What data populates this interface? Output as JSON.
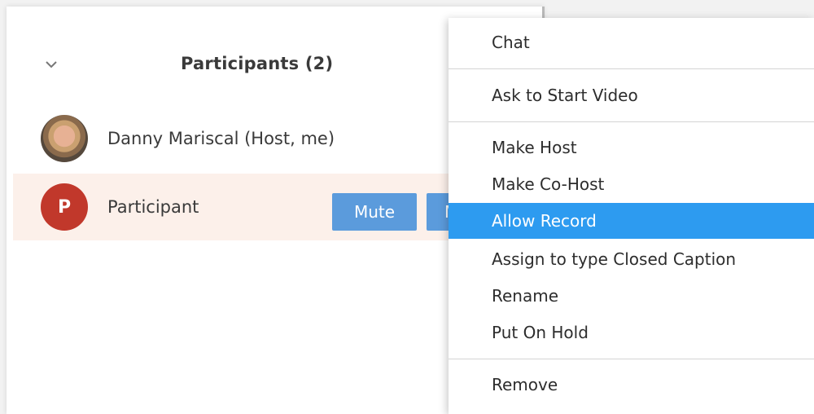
{
  "panel": {
    "title": "Participants (2)"
  },
  "participants": [
    {
      "name": "Danny Mariscal (Host, me)",
      "avatar": "photo"
    },
    {
      "name": "Participant",
      "initial": "P",
      "buttons": {
        "mute": "Mute",
        "more": "M"
      }
    }
  ],
  "context_menu": {
    "items": [
      {
        "label": "Chat"
      },
      {
        "label": "Ask to Start Video"
      },
      {
        "label": "Make Host"
      },
      {
        "label": "Make Co-Host"
      },
      {
        "label": "Allow Record",
        "highlighted": true
      },
      {
        "label": "Assign to type Closed Caption"
      },
      {
        "label": "Rename"
      },
      {
        "label": "Put On Hold"
      },
      {
        "label": "Remove"
      }
    ]
  },
  "colors": {
    "highlight": "#2d9bf0",
    "button": "#5b9bdc",
    "avatar_red": "#c1382b",
    "participant_row_bg": "#fcf0ea"
  },
  "icons": {
    "collapse": "chevron-down-icon"
  }
}
